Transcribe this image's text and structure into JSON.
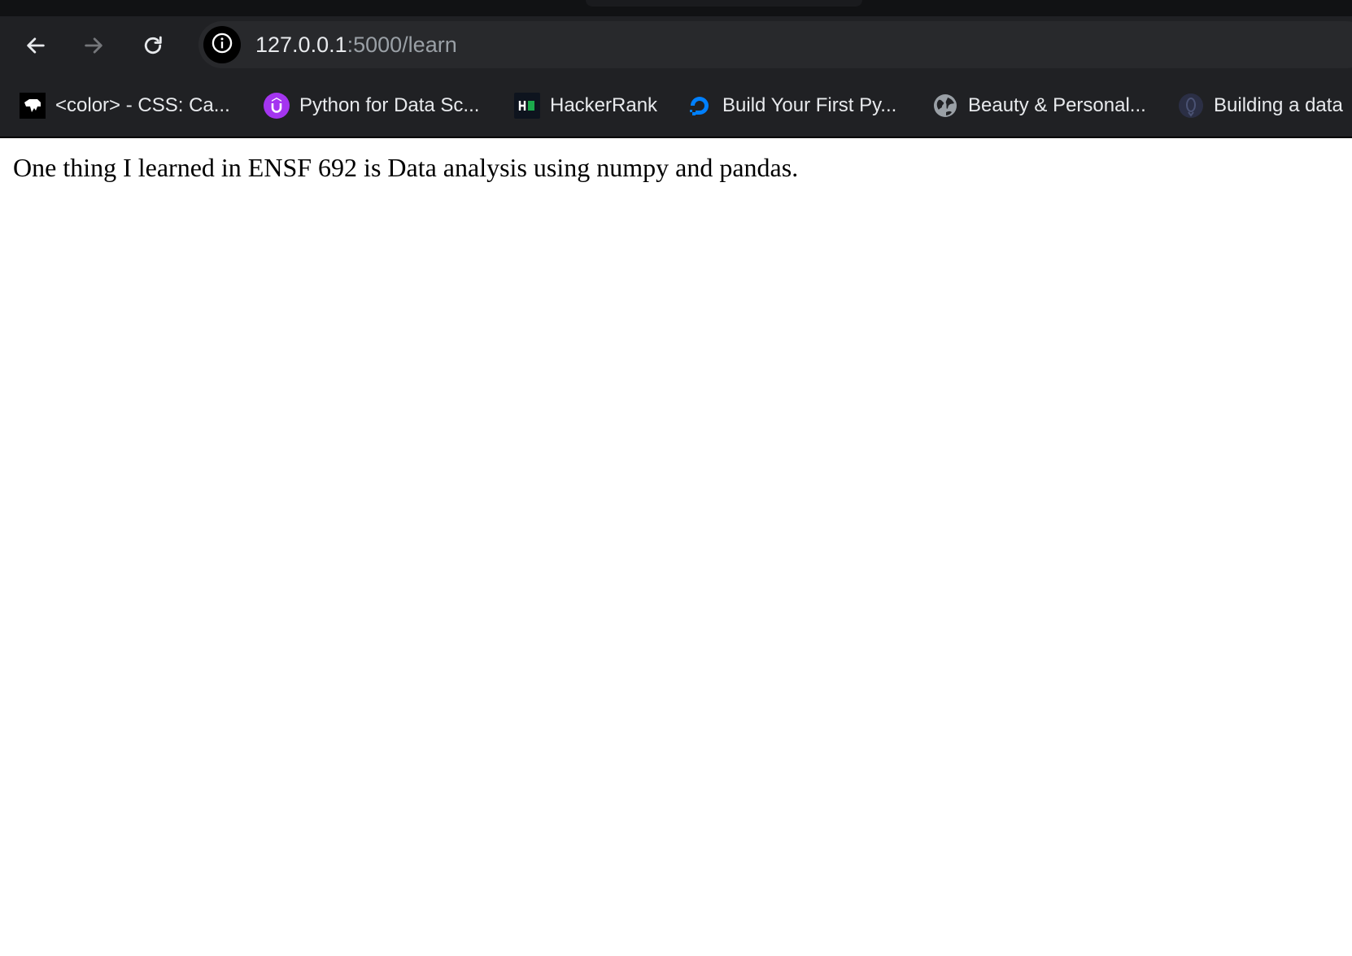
{
  "browser": {
    "toolbar": {
      "back_icon": "arrow-left-icon",
      "forward_icon": "arrow-right-icon",
      "reload_icon": "reload-icon",
      "site_info_icon": "info-icon",
      "url_host": "127.0.0.1",
      "url_path": ":5000/learn"
    },
    "bookmarks": [
      {
        "label": "<color> - CSS: Ca...",
        "icon": "mdn-icon"
      },
      {
        "label": "Python for Data Sc...",
        "icon": "udemy-icon"
      },
      {
        "label": "HackerRank",
        "icon": "hackerrank-icon"
      },
      {
        "label": "Build Your First Py...",
        "icon": "digitalocean-icon"
      },
      {
        "label": "Beauty & Personal...",
        "icon": "globe-icon"
      },
      {
        "label": "Building a data",
        "icon": "site-icon"
      }
    ],
    "colors": {
      "toolbar_bg": "#202124",
      "omnibox_bg": "#28292c",
      "tabstrip_bg": "#111214",
      "url_host": "#e8eaed",
      "url_path": "#9aa0a6",
      "udemy_purple": "#a435f0",
      "hackerrank_green": "#1ba94c",
      "digitalocean_blue": "#0080ff"
    }
  },
  "page": {
    "text": "One thing I learned in ENSF 692 is Data analysis using numpy and pandas."
  }
}
